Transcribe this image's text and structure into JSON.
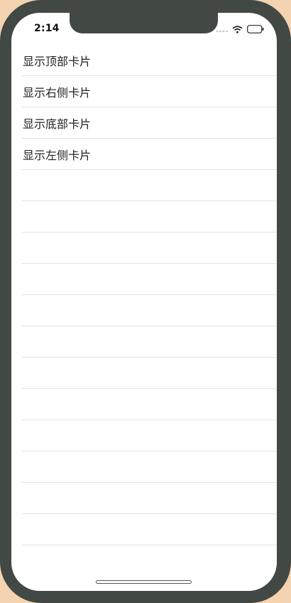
{
  "status_bar": {
    "time": "2:14",
    "icons": [
      "signal-icon",
      "wifi-icon",
      "battery-icon"
    ]
  },
  "list": {
    "items": [
      {
        "label": "显示顶部卡片"
      },
      {
        "label": "显示右侧卡片"
      },
      {
        "label": "显示底部卡片"
      },
      {
        "label": "显示左侧卡片"
      },
      {
        "label": ""
      },
      {
        "label": ""
      },
      {
        "label": ""
      },
      {
        "label": ""
      },
      {
        "label": ""
      },
      {
        "label": ""
      },
      {
        "label": ""
      },
      {
        "label": ""
      },
      {
        "label": ""
      },
      {
        "label": ""
      },
      {
        "label": ""
      },
      {
        "label": ""
      }
    ]
  },
  "colors": {
    "background": "#f3d3b0",
    "frame": "#424844",
    "screen": "#ffffff",
    "separator": "#e4e4e4",
    "text": "#222222"
  }
}
